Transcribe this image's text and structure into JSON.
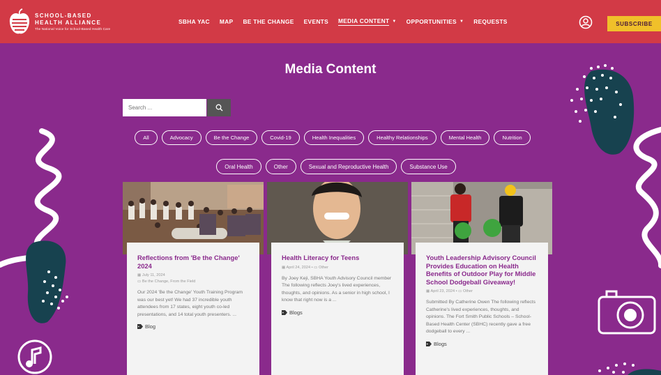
{
  "header": {
    "logo": {
      "line1": "SCHOOL-BASED",
      "line2": "HEALTH ALLIANCE",
      "tagline": "The National Voice for School-Based Health Care"
    },
    "nav": [
      {
        "label": "SBHA YAC",
        "has_caret": false,
        "active": false
      },
      {
        "label": "MAP",
        "has_caret": false,
        "active": false
      },
      {
        "label": "BE THE CHANGE",
        "has_caret": false,
        "active": false
      },
      {
        "label": "EVENTS",
        "has_caret": false,
        "active": false
      },
      {
        "label": "MEDIA CONTENT",
        "has_caret": true,
        "active": true
      },
      {
        "label": "OPPORTUNITIES",
        "has_caret": true,
        "active": false
      },
      {
        "label": "REQUESTS",
        "has_caret": false,
        "active": false
      }
    ],
    "subscribe_label": "SUBSCRIBE"
  },
  "main": {
    "title": "Media Content",
    "search": {
      "placeholder": "Search ..."
    },
    "filters_row1": [
      "All",
      "Advocacy",
      "Be the Change",
      "Covid-19",
      "Health Inequalities",
      "Healthy Relationships",
      "Mental Health",
      "Nutrition"
    ],
    "filters_row2": [
      "Oral Health",
      "Other",
      "Sexual and Reproductive Health",
      "Substance Use"
    ],
    "cards": [
      {
        "title": "Reflections from 'Be the Change' 2024",
        "date": "July 11, 2024",
        "categories": "Be the Change, From the Field",
        "excerpt": "Our 2024 'Be the Change' Youth Training Program was our best yet! We had 37 incredible youth attendees from 17 states, eight youth co-led presentations, and 14 total youth presenters. ...",
        "tag": "Blog"
      },
      {
        "title": "Health Literacy for Teens",
        "date": "April 24, 2024",
        "categories": "Other",
        "excerpt": "By Joey Keji, SBHA Youth Advisory Council member The following reflects Joey's lived experiences, thoughts, and opinions. As a senior in high school, I know that right now is a ...",
        "tag": "Blogs"
      },
      {
        "title": "Youth Leadership Advisory Council Provides Education on Health Benefits of Outdoor Play for Middle School Dodgeball Giveaway!",
        "date": "April 23, 2024",
        "categories": "Other",
        "excerpt": "Submitted By Catherine Owen The following reflects Catherine's lived experiences, thoughts, and opinions. The Fort Smith Public Schools – School-Based Health Center (SBHC) recently gave a free dodgeball to every ...",
        "tag": "Blogs"
      }
    ]
  },
  "colors": {
    "header_red": "#d23a46",
    "page_purple": "#8a2a8c",
    "subscribe_yellow": "#f0c02a",
    "card_title_purple": "#8a2a8c",
    "deco_teal": "#17424f"
  },
  "icons": {
    "user": "user-circle-icon",
    "search": "search-icon",
    "tag": "tag-icon",
    "music": "music-note-icon",
    "camera": "camera-icon"
  }
}
